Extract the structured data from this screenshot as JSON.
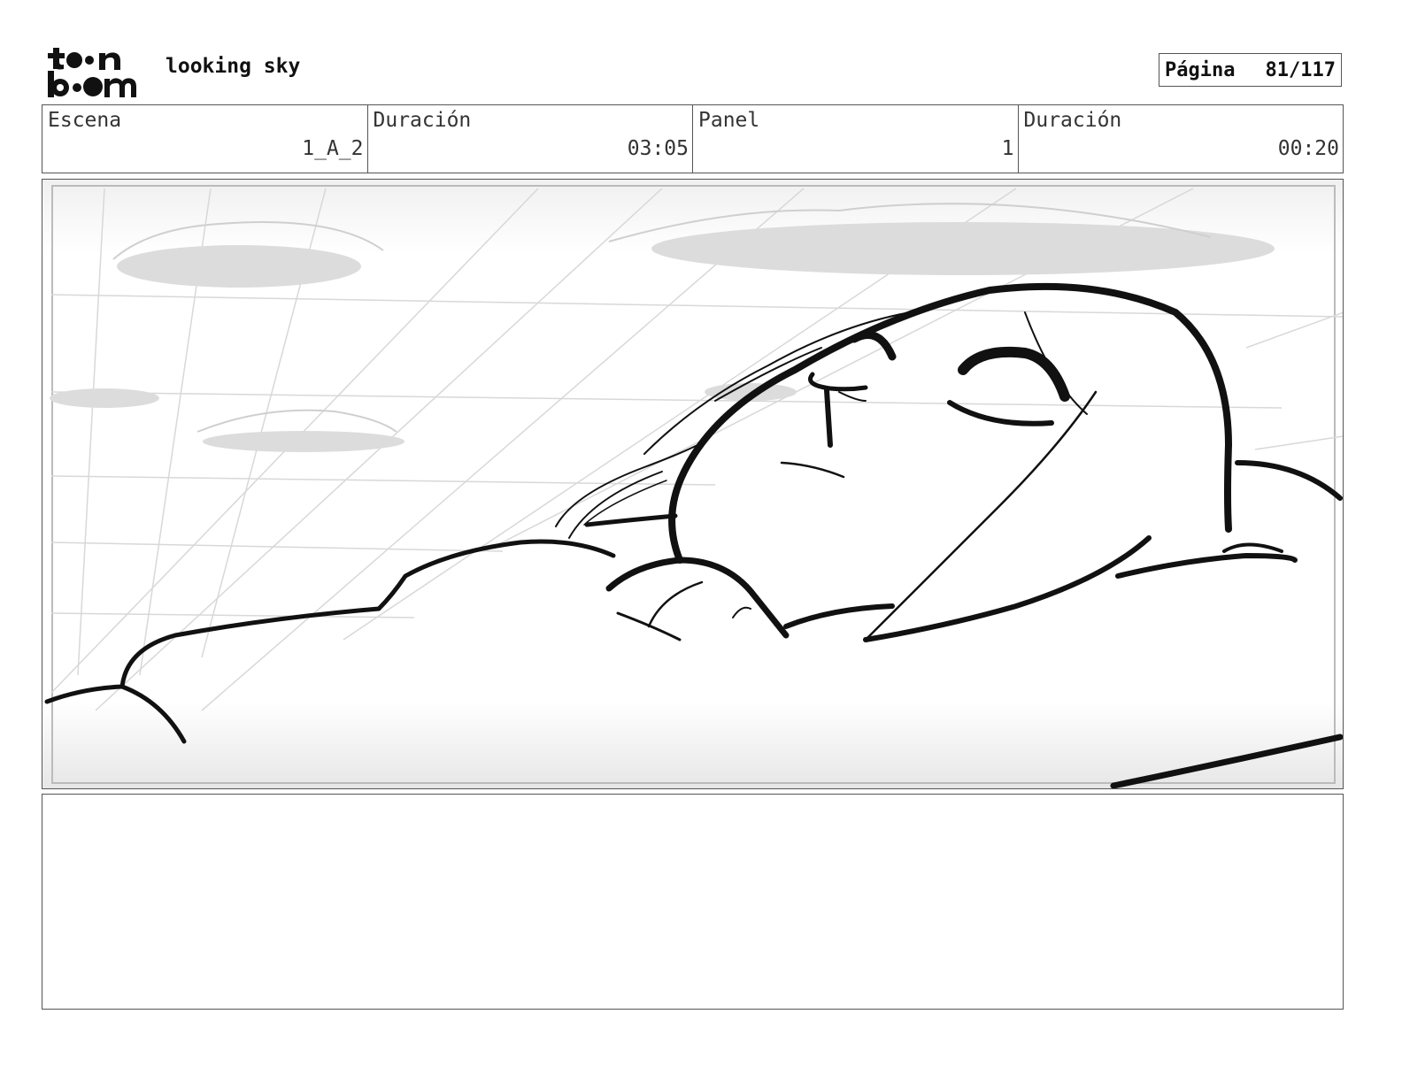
{
  "header": {
    "logo_alt": "toon boom",
    "project_title": "looking sky",
    "page_label": "Página",
    "page_number": "81/117"
  },
  "info": [
    {
      "label": "Escena",
      "value": "1_A_2"
    },
    {
      "label": "Duración",
      "value": "03:05"
    },
    {
      "label": "Panel",
      "value": "1"
    },
    {
      "label": "Duración",
      "value": "00:20"
    }
  ],
  "panel": {
    "image_content": "sketch"
  },
  "notes": {
    "text": ""
  }
}
